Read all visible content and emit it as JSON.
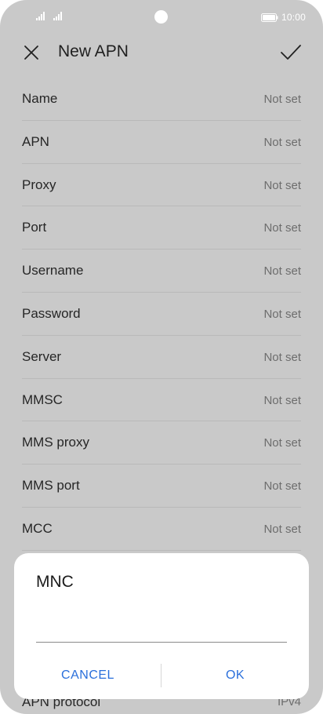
{
  "status_bar": {
    "time": "10:00",
    "icons": [
      "signal-icon",
      "signal-icon",
      "camera-cutout",
      "battery-icon"
    ]
  },
  "app_bar": {
    "title": "New APN",
    "close_icon": "close-icon",
    "confirm_icon": "check-icon"
  },
  "settings": {
    "items": [
      {
        "label": "Name",
        "value": "Not set"
      },
      {
        "label": "APN",
        "value": "Not set"
      },
      {
        "label": "Proxy",
        "value": "Not set"
      },
      {
        "label": "Port",
        "value": "Not set"
      },
      {
        "label": "Username",
        "value": "Not set"
      },
      {
        "label": "Password",
        "value": "Not set"
      },
      {
        "label": "Server",
        "value": "Not set"
      },
      {
        "label": "MMSC",
        "value": "Not set"
      },
      {
        "label": "MMS proxy",
        "value": "Not set"
      },
      {
        "label": "MMS port",
        "value": "Not set"
      },
      {
        "label": "MCC",
        "value": "Not set"
      }
    ],
    "partial_item": {
      "label": "APN protocol",
      "value": "IPv4"
    }
  },
  "dialog": {
    "title": "MNC",
    "input_value": "",
    "cancel_label": "CANCEL",
    "ok_label": "OK"
  },
  "colors": {
    "overlay_background": "#c9c9c9",
    "dialog_background": "#ffffff",
    "button_accent": "#2a6fdb"
  }
}
